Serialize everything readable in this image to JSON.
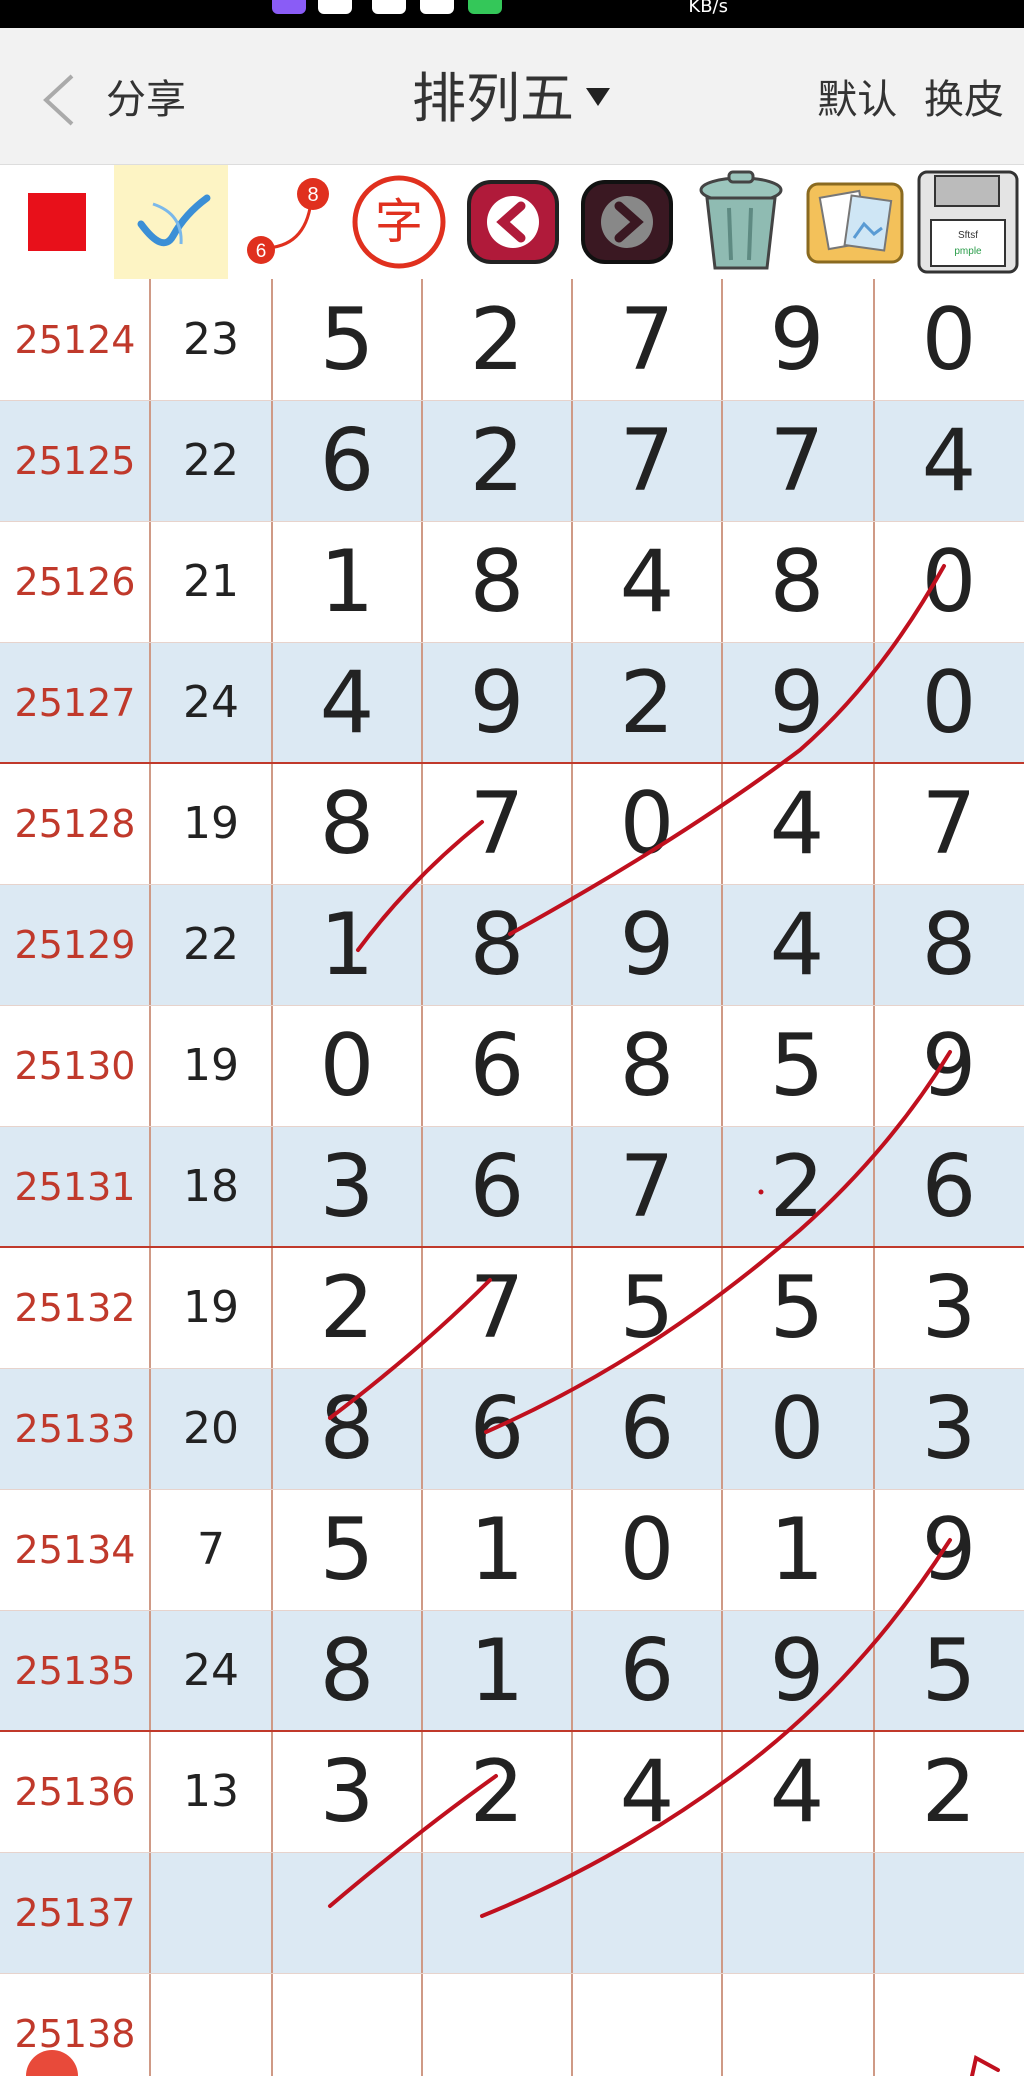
{
  "header": {
    "share_label": "分享",
    "title": "排列五",
    "default_label": "默认",
    "skin_label": "换皮"
  },
  "status": {
    "speed_unit": "KB/s"
  },
  "toolbar": {
    "bubble_top": "8",
    "bubble_bottom": "6",
    "char_icon_text": "字",
    "disk_label_1": "Sftsf",
    "disk_label_2": "pmple"
  },
  "rows": [
    {
      "issue": "25124",
      "sum": "23",
      "digits": [
        "5",
        "2",
        "7",
        "9",
        "0"
      ]
    },
    {
      "issue": "25125",
      "sum": "22",
      "digits": [
        "6",
        "2",
        "7",
        "7",
        "4"
      ]
    },
    {
      "issue": "25126",
      "sum": "21",
      "digits": [
        "1",
        "8",
        "4",
        "8",
        "0"
      ]
    },
    {
      "issue": "25127",
      "sum": "24",
      "digits": [
        "4",
        "9",
        "2",
        "9",
        "0"
      ]
    },
    {
      "issue": "25128",
      "sum": "19",
      "digits": [
        "8",
        "7",
        "0",
        "4",
        "7"
      ]
    },
    {
      "issue": "25129",
      "sum": "22",
      "digits": [
        "1",
        "8",
        "9",
        "4",
        "8"
      ]
    },
    {
      "issue": "25130",
      "sum": "19",
      "digits": [
        "0",
        "6",
        "8",
        "5",
        "9"
      ]
    },
    {
      "issue": "25131",
      "sum": "18",
      "digits": [
        "3",
        "6",
        "7",
        "2",
        "6"
      ]
    },
    {
      "issue": "25132",
      "sum": "19",
      "digits": [
        "2",
        "7",
        "5",
        "5",
        "3"
      ]
    },
    {
      "issue": "25133",
      "sum": "20",
      "digits": [
        "8",
        "6",
        "6",
        "0",
        "3"
      ]
    },
    {
      "issue": "25134",
      "sum": "7",
      "digits": [
        "5",
        "1",
        "0",
        "1",
        "9"
      ]
    },
    {
      "issue": "25135",
      "sum": "24",
      "digits": [
        "8",
        "1",
        "6",
        "9",
        "5"
      ]
    },
    {
      "issue": "25136",
      "sum": "13",
      "digits": [
        "3",
        "2",
        "4",
        "4",
        "2"
      ]
    },
    {
      "issue": "25137",
      "sum": "",
      "digits": [
        "",
        "",
        "",
        "",
        ""
      ]
    },
    {
      "issue": "25138",
      "sum": "",
      "digits": [
        "",
        "",
        "",
        "",
        ""
      ]
    }
  ],
  "colors": {
    "accent_red": "#c0392b",
    "stripe_blue": "#dce9f3",
    "pen_red": "#c0101e"
  }
}
